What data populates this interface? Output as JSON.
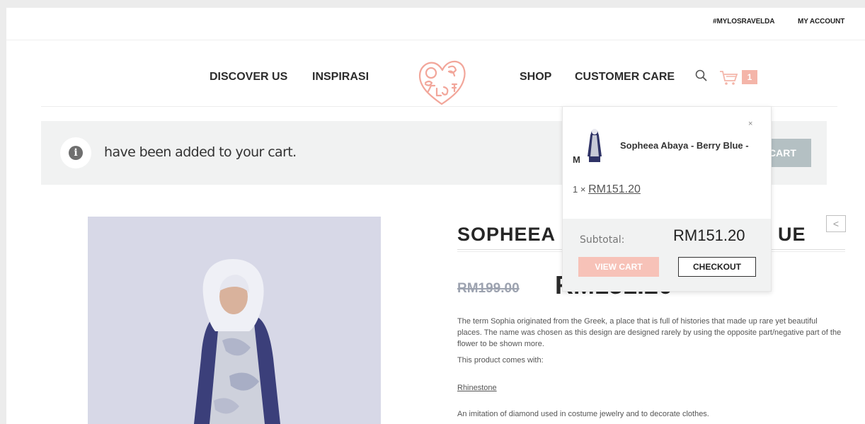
{
  "top_links": {
    "hashtag": "#MYLOSRAVELDA",
    "account": "MY ACCOUNT"
  },
  "nav": {
    "discover": "DISCOVER US",
    "inspirasi": "INSPIRASI",
    "shop": "SHOP",
    "customer_care": "CUSTOMER CARE"
  },
  "logo_text": "Los Ravelda",
  "cart": {
    "count": "1"
  },
  "notice": {
    "text": "have been added to your cart.",
    "button": "CART"
  },
  "product": {
    "title": "SOPHEEA",
    "title_tail": "UE",
    "old_price": "RM199.00",
    "new_price": "RM151.20",
    "description": [
      "The term Sophia originated from the Greek, a place that is full of histories that made up rare yet beautiful places. The name was chosen as this design are designed rarely by using the opposite part/negative part of the flower to be shown more.",
      "This product comes with:"
    ],
    "feature_link": "Rhinestone",
    "feature_desc": "An imitation of diamond used in costume jewelry and to decorate clothes."
  },
  "mini_cart": {
    "item_name": "Sopheea Abaya - Berry Blue - M",
    "qty_prefix": "1 ×",
    "item_price": "RM151.20",
    "subtotal_label": "Subtotal:",
    "subtotal_value": "RM151.20",
    "view_cart": "VIEW CART",
    "checkout": "CHECKOUT",
    "close": "×"
  },
  "colors": {
    "accent_pink": "#f4b5a9",
    "notice_bg": "#f1f2f2",
    "nav_text": "#2d2d2d"
  }
}
